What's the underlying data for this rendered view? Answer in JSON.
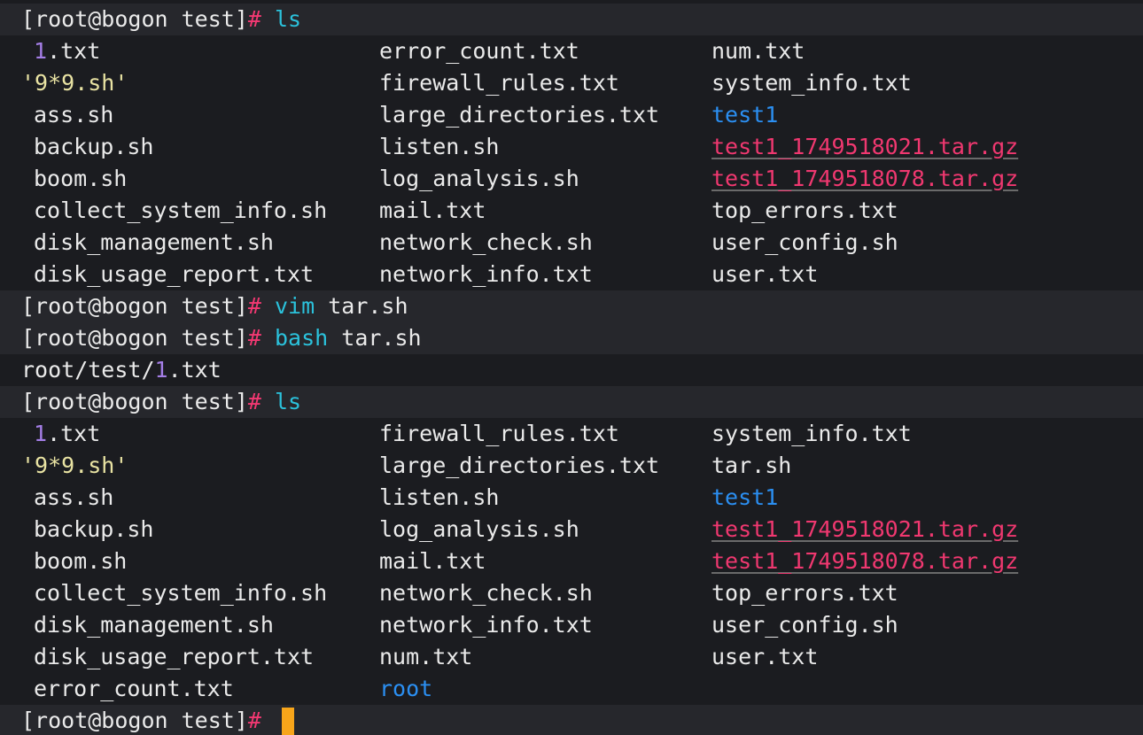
{
  "prompt": "[root@bogon test]",
  "hash": "#",
  "commands": {
    "ls1": "ls",
    "vim": "vim",
    "vim_arg": "tar.sh",
    "bash": "bash",
    "bash_arg": "tar.sh",
    "ls2": "ls"
  },
  "listing1": {
    "col1": [
      "1",
      ".txt",
      "'9*9.sh'",
      "ass.sh",
      "backup.sh",
      "boom.sh",
      "collect_system_info.sh",
      "disk_management.sh",
      "disk_usage_report.txt"
    ],
    "col2": [
      "error_count.txt",
      "firewall_rules.txt",
      "large_directories.txt",
      "listen.sh",
      "log_analysis.sh",
      "mail.txt",
      "network_check.sh",
      "network_info.txt"
    ],
    "col3": [
      "num.txt",
      "system_info.txt",
      "test1",
      "test1_1749518021.tar.gz",
      "test1_1749518078.tar.gz",
      "top_errors.txt",
      "user_config.sh",
      "user.txt"
    ]
  },
  "output_line": {
    "prefix": "root/test/",
    "num": "1",
    "suffix": ".txt"
  },
  "listing2": {
    "col1": [
      "1",
      ".txt",
      "'9*9.sh'",
      "ass.sh",
      "backup.sh",
      "boom.sh",
      "collect_system_info.sh",
      "disk_management.sh",
      "disk_usage_report.txt",
      "error_count.txt"
    ],
    "col2": [
      "firewall_rules.txt",
      "large_directories.txt",
      "listen.sh",
      "log_analysis.sh",
      "mail.txt",
      "network_check.sh",
      "network_info.txt",
      "num.txt",
      "root"
    ],
    "col3": [
      "system_info.txt",
      "tar.sh",
      "test1",
      "test1_1749518021.tar.gz",
      "test1_1749518078.tar.gz",
      "top_errors.txt",
      "user_config.sh",
      "user.txt"
    ]
  },
  "colors": {
    "hash": "#f33872",
    "command": "#2bc2dc",
    "number": "#a47ee6",
    "quoted": "#e9e3a3",
    "directory": "#2b8ff2",
    "archive": "#f03870",
    "cursor": "#f7a51a"
  }
}
